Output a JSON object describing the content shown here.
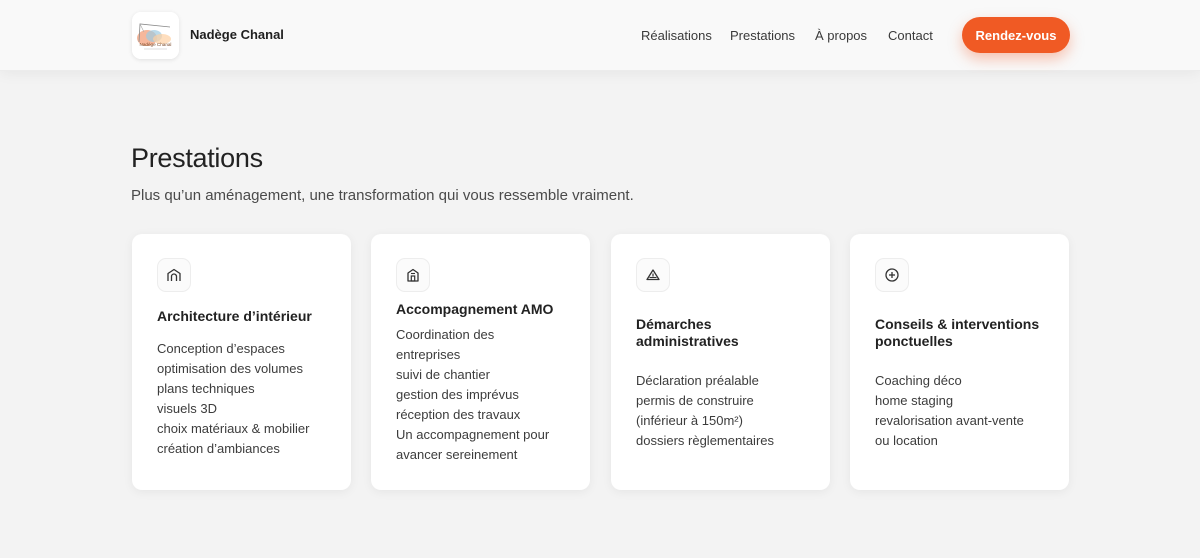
{
  "header": {
    "logo_text": "Nadège Chanal",
    "brand_name": "Nadège Chanal",
    "nav": [
      {
        "label": "Réalisations"
      },
      {
        "label": "Prestations"
      },
      {
        "label": "À propos"
      },
      {
        "label": "Contact"
      }
    ],
    "cta_label": "Rendez-vous",
    "accent_color": "#f05a24"
  },
  "main": {
    "title": "Prestations",
    "subtitle": "Plus qu’un aménagement, une transformation qui vous ressemble vraiment.",
    "cards": [
      {
        "icon": "house-arch-icon",
        "title": "Architecture d’intérieur",
        "items": [
          "Conception d’espaces",
          "optimisation des volumes",
          "plans techniques",
          "visuels 3D",
          "choix matériaux & mobilier",
          "création d’ambiances"
        ]
      },
      {
        "icon": "building-icon",
        "title": "Accompagnement AMO",
        "items": [
          "Coordination des",
          "entreprises",
          "suivi de chantier",
          "gestion des imprévus",
          "réception des travaux",
          "Un accompagnement pour",
          "avancer sereinement"
        ]
      },
      {
        "icon": "warning-triangle-icon",
        "title": "Démarches administratives",
        "items": [
          "Déclaration préalable",
          "permis de construire",
          "(inférieur à 150m²)",
          "dossiers règlementaires"
        ]
      },
      {
        "icon": "plus-circle-icon",
        "title": "Conseils & interventions ponctuelles",
        "items": [
          "Coaching déco",
          "home staging",
          "revalorisation avant-vente",
          "ou location"
        ]
      }
    ]
  }
}
